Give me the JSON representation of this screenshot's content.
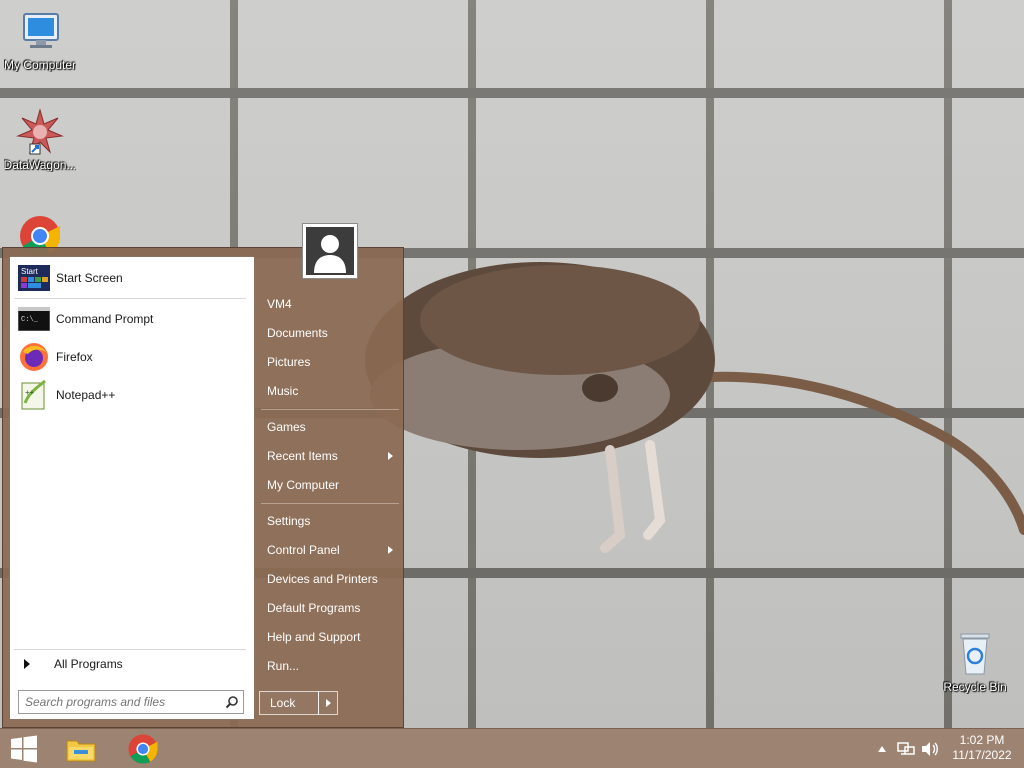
{
  "desktop": {
    "icons": [
      {
        "label": "My Computer",
        "icon": "monitor-icon"
      },
      {
        "label": "DataWagon...",
        "icon": "datawagon-icon"
      },
      {
        "label": "",
        "icon": "chrome-icon"
      },
      {
        "label": "Recycle Bin",
        "icon": "recycle-bin-icon"
      }
    ]
  },
  "start_menu": {
    "programs": [
      {
        "label": "Start Screen",
        "icon": "start-screen-icon"
      },
      {
        "label": "Command Prompt",
        "icon": "command-prompt-icon"
      },
      {
        "label": "Firefox",
        "icon": "firefox-icon"
      },
      {
        "label": "Notepad++",
        "icon": "notepadpp-icon"
      }
    ],
    "start_screen_icon_text": "Start",
    "cmd_icon_text": "C:\\_",
    "all_programs": "All Programs",
    "search_placeholder": "Search programs and files",
    "right_items": [
      {
        "label": "VM4"
      },
      {
        "label": "Documents"
      },
      {
        "label": "Pictures"
      },
      {
        "label": "Music"
      },
      {
        "label": "Games"
      },
      {
        "label": "Recent Items",
        "submenu": true
      },
      {
        "label": "My Computer"
      },
      {
        "label": "Settings"
      },
      {
        "label": "Control Panel",
        "submenu": true
      },
      {
        "label": "Devices and Printers"
      },
      {
        "label": "Default Programs"
      },
      {
        "label": "Help and Support"
      },
      {
        "label": "Run..."
      }
    ],
    "lock_label": "Lock"
  },
  "taskbar": {
    "pinned": [
      "windows-start-icon",
      "file-explorer-icon",
      "chrome-icon"
    ],
    "clock_time": "1:02 PM",
    "clock_date": "11/17/2022",
    "tray": [
      "show-hidden-icons",
      "network-icon",
      "volume-icon"
    ]
  },
  "colors": {
    "menu_bg": "#8b6952",
    "taskbar_bg": "#987e6c"
  }
}
